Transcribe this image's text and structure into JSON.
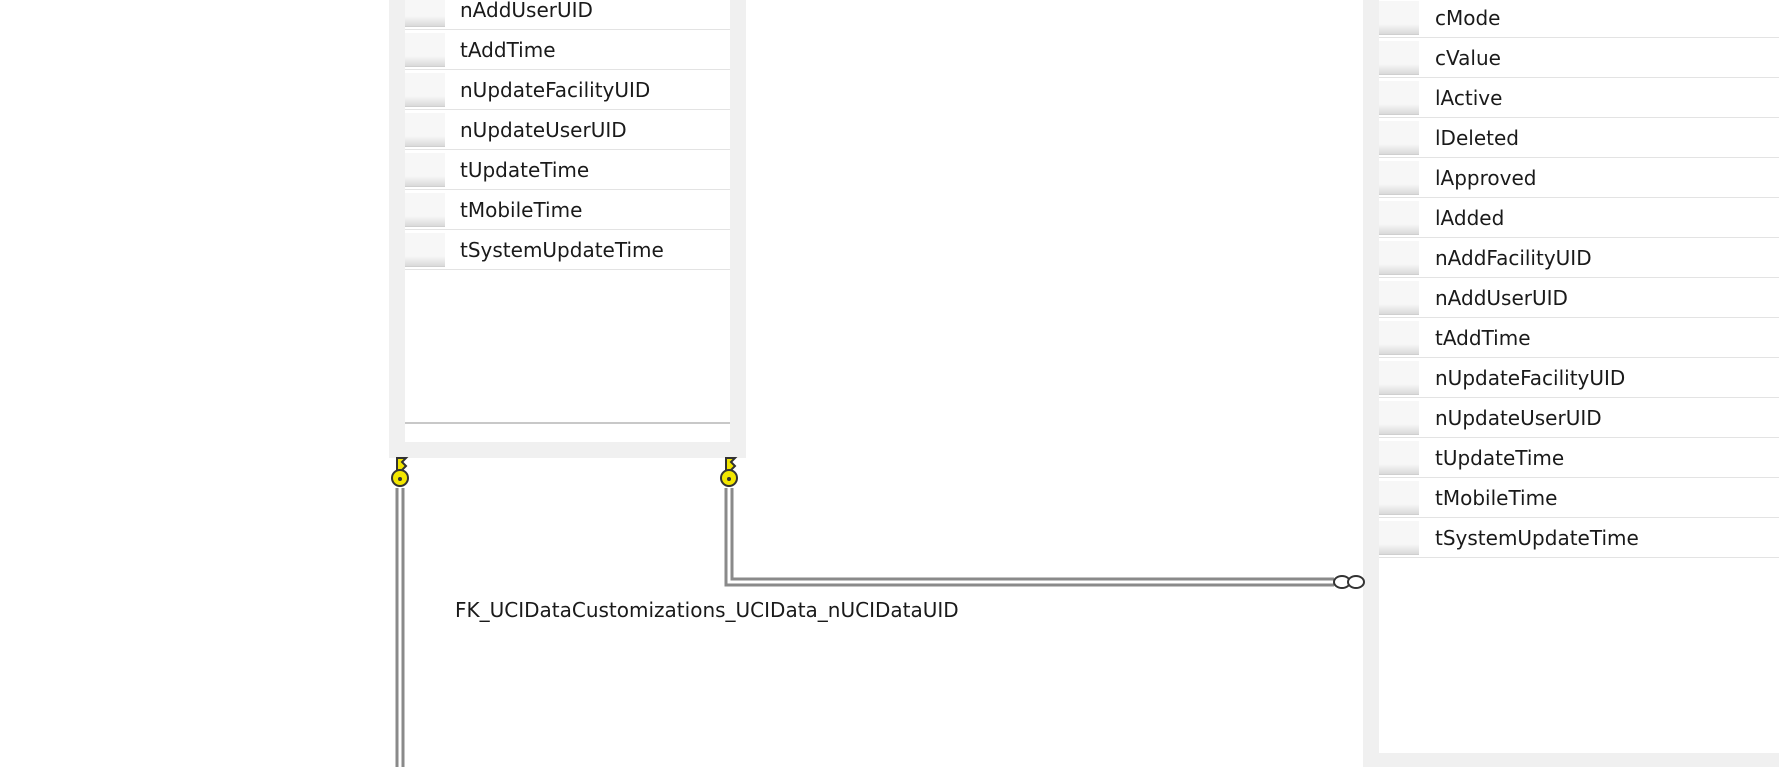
{
  "left_table": {
    "rows": [
      {
        "label": "nAddUserUID"
      },
      {
        "label": "tAddTime"
      },
      {
        "label": "nUpdateFacilityUID"
      },
      {
        "label": "nUpdateUserUID"
      },
      {
        "label": "tUpdateTime"
      },
      {
        "label": "tMobileTime"
      },
      {
        "label": "tSystemUpdateTime"
      }
    ]
  },
  "right_table": {
    "rows": [
      {
        "label": "cMode"
      },
      {
        "label": "cValue"
      },
      {
        "label": "lActive"
      },
      {
        "label": "lDeleted"
      },
      {
        "label": "lApproved"
      },
      {
        "label": "lAdded"
      },
      {
        "label": "nAddFacilityUID"
      },
      {
        "label": "nAddUserUID"
      },
      {
        "label": "tAddTime"
      },
      {
        "label": "nUpdateFacilityUID"
      },
      {
        "label": "nUpdateUserUID"
      },
      {
        "label": "tUpdateTime"
      },
      {
        "label": "tMobileTime"
      },
      {
        "label": "tSystemUpdateTime"
      }
    ]
  },
  "relationship": {
    "label": "FK_UCIDataCustomizations_UCIData_nUCIDataUID",
    "one_end": "key-icon",
    "many_end": "infinity-icon"
  },
  "colors": {
    "key_fill": "#f2e600",
    "connector": "#8a8a8a",
    "frame": "#f0f0f0"
  }
}
